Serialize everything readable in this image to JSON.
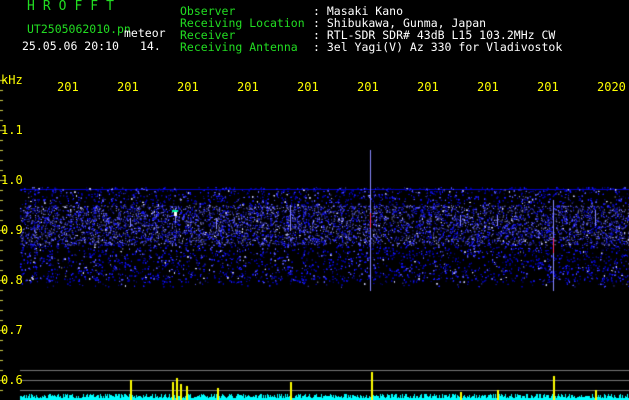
{
  "app": {
    "brand": "HROFFT",
    "filename": "UT2505062010.pn",
    "tag": "meteor",
    "datetime": "25.05.06 20:10",
    "minute": "14."
  },
  "header": {
    "rows": [
      {
        "label": "Observer",
        "value": ": Masaki Kano"
      },
      {
        "label": "Receiving Location",
        "value": ": Shibukawa, Gunma, Japan"
      },
      {
        "label": "Receiver",
        "value": ": RTL-SDR SDR# 43dB L15 103.2MHz CW"
      },
      {
        "label": "Receiving Antenna",
        "value": ": 3el Yagi(V) Az 330 for Vladivostok"
      }
    ]
  },
  "axes": {
    "y_unit": "kHz",
    "y_ticks": [
      "1.1",
      "1.0",
      "0.9",
      "0.8",
      "0.7",
      "0.6"
    ],
    "x_ticks": [
      "201",
      "201",
      "201",
      "201",
      "201",
      "201",
      "201",
      "201",
      "201",
      "2020"
    ]
  },
  "colors": {
    "header_label": "#22dd22",
    "header_value": "#ffffff",
    "axis": "#ffff00",
    "noise_band": "#0000aa",
    "amplitude": "#00ffff"
  }
}
